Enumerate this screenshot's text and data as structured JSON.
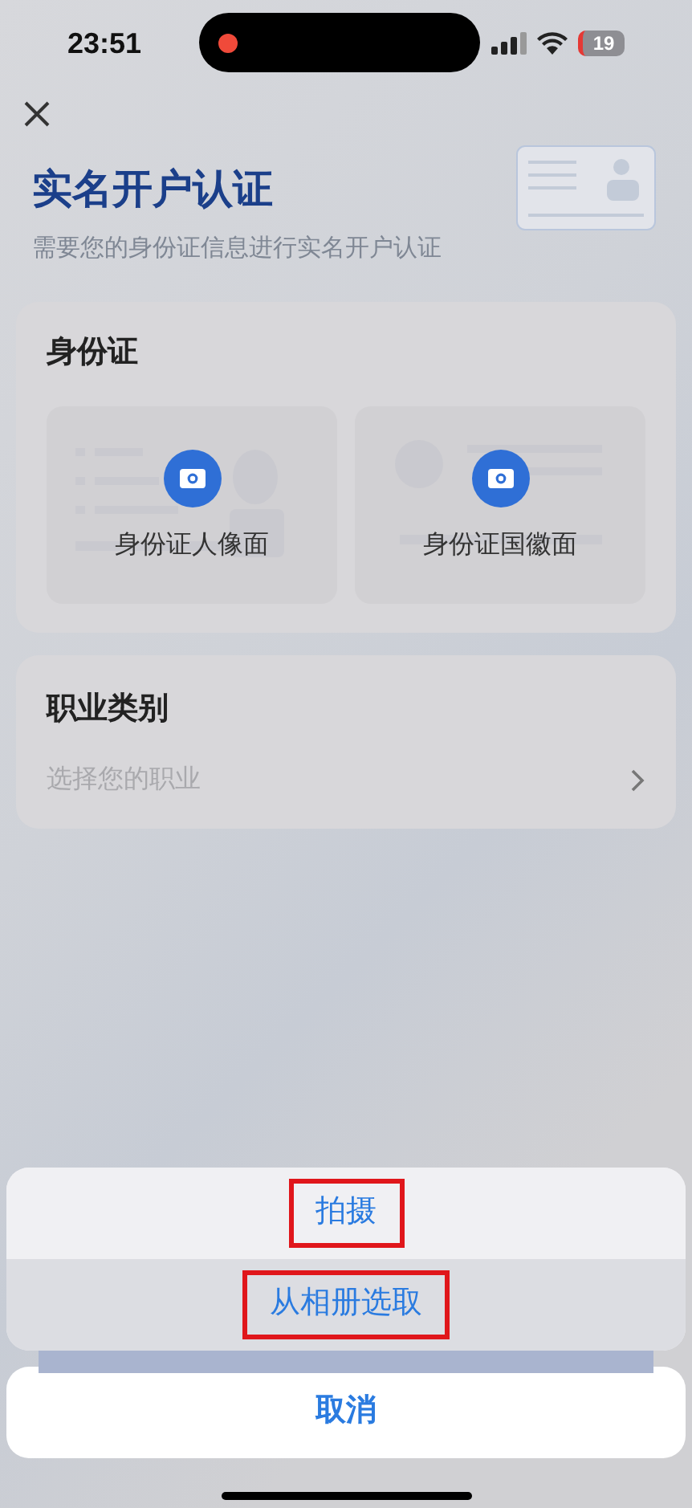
{
  "status_bar": {
    "time": "23:51",
    "battery": "19",
    "recording": true
  },
  "header": {
    "title": "实名开户认证",
    "subtitle": "需要您的身份证信息进行实名开户认证"
  },
  "id_card_section": {
    "title": "身份证",
    "sides": [
      {
        "label": "身份证人像面",
        "kind": "portrait"
      },
      {
        "label": "身份证国徽面",
        "kind": "emblem"
      }
    ]
  },
  "occupation_section": {
    "title": "职业类别",
    "placeholder": "选择您的职业"
  },
  "action_sheet": {
    "options": [
      {
        "label": "拍摄",
        "highlighted": true,
        "selected": false
      },
      {
        "label": "从相册选取",
        "highlighted": true,
        "selected": true
      }
    ],
    "cancel": "取消"
  }
}
